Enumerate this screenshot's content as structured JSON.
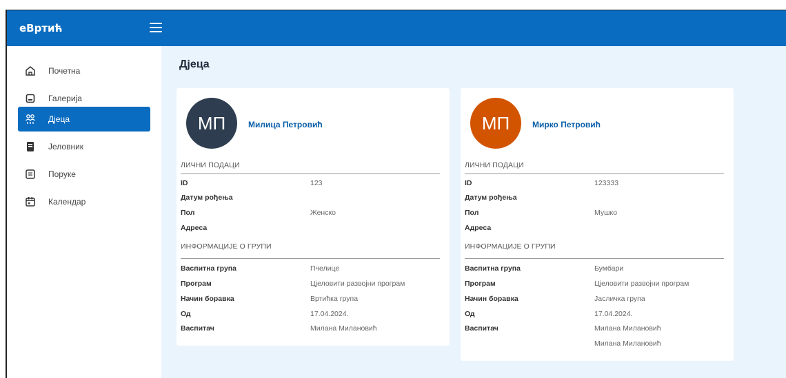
{
  "app": {
    "brand": "еВртић"
  },
  "sidebar": {
    "items": [
      {
        "label": "Почетна",
        "icon": "home-icon"
      },
      {
        "label": "Галерија",
        "icon": "gallery-icon"
      },
      {
        "label": "Дјеца",
        "icon": "children-icon",
        "active": true
      },
      {
        "label": "Јеловник",
        "icon": "menu-book-icon"
      },
      {
        "label": "Поруке",
        "icon": "message-icon"
      },
      {
        "label": "Календар",
        "icon": "calendar-icon"
      }
    ]
  },
  "main": {
    "title": "Дјеца",
    "children": [
      {
        "initials": "МП",
        "name": "Милица Петровић",
        "avatar_color": "#2e3e50",
        "personal_header": "ЛИЧНИ ПОДАЦИ",
        "id_label": "ID",
        "id_value": "123",
        "dob_label": "Датум рођења",
        "dob_value": "",
        "sex_label": "Пол",
        "sex_value": "Женско",
        "address_label": "Адреса",
        "address_value": "",
        "group_header": "ИНФОРМАЦИЈЕ О ГРУПИ",
        "group_label": "Васпитна група",
        "group_value": "Пчелице",
        "program_label": "Програм",
        "program_value": "Цјеловити развојни програм",
        "stay_label": "Начин боравка",
        "stay_value": "Вртићка група",
        "from_label": "Од",
        "from_value": "17.04.2024.",
        "teacher_label": "Васпитач",
        "teachers": [
          "Милана Милановић"
        ]
      },
      {
        "initials": "МП",
        "name": "Мирко Петровић",
        "avatar_color": "#d35400",
        "personal_header": "ЛИЧНИ ПОДАЦИ",
        "id_label": "ID",
        "id_value": "123333",
        "dob_label": "Датум рођења",
        "dob_value": "",
        "sex_label": "Пол",
        "sex_value": "Мушко",
        "address_label": "Адреса",
        "address_value": "",
        "group_header": "ИНФОРМАЦИЈЕ О ГРУПИ",
        "group_label": "Васпитна група",
        "group_value": "Бумбари",
        "program_label": "Програм",
        "program_value": "Цјеловити развојни програм",
        "stay_label": "Начин боравка",
        "stay_value": "Јасличка група",
        "from_label": "Од",
        "from_value": "17.04.2024.",
        "teacher_label": "Васпитач",
        "teachers": [
          "Милана Милановић",
          "Милана Милановић"
        ]
      }
    ]
  },
  "colors": {
    "primary": "#0a6cc0",
    "background": "#eaf4fd",
    "name_link": "#0a5fa8"
  }
}
